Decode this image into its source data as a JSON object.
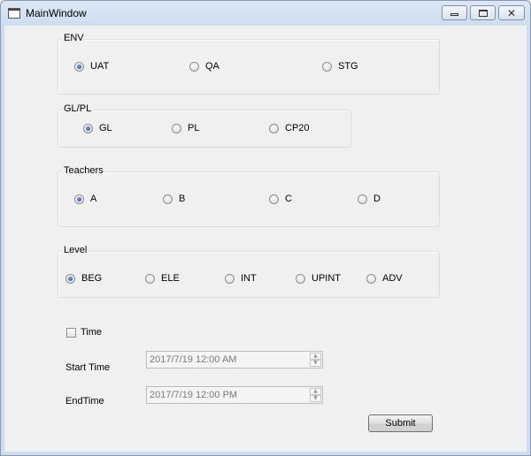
{
  "window": {
    "title": "MainWindow"
  },
  "groups": {
    "env": {
      "label": "ENV",
      "options": [
        "UAT",
        "QA",
        "STG"
      ],
      "selected": "UAT"
    },
    "glpl": {
      "label": "GL/PL",
      "options": [
        "GL",
        "PL",
        "CP20"
      ],
      "selected": "GL"
    },
    "teachers": {
      "label": "Teachers",
      "options": [
        "A",
        "B",
        "C",
        "D"
      ],
      "selected": "A"
    },
    "level": {
      "label": "Level",
      "options": [
        "BEG",
        "ELE",
        "INT",
        "UPINT",
        "ADV"
      ],
      "selected": "BEG"
    }
  },
  "time": {
    "label": "Time",
    "checked": false
  },
  "start_time": {
    "label": "Start Time",
    "value": "2017/7/19 12:00 AM"
  },
  "end_time": {
    "label": "EndTime",
    "value": "2017/7/19 12:00 PM"
  },
  "submit": {
    "label": "Submit"
  },
  "icons": [
    "window-icon",
    "minimize-icon",
    "maximize-icon",
    "close-icon",
    "spin-up-icon",
    "spin-down-icon"
  ]
}
